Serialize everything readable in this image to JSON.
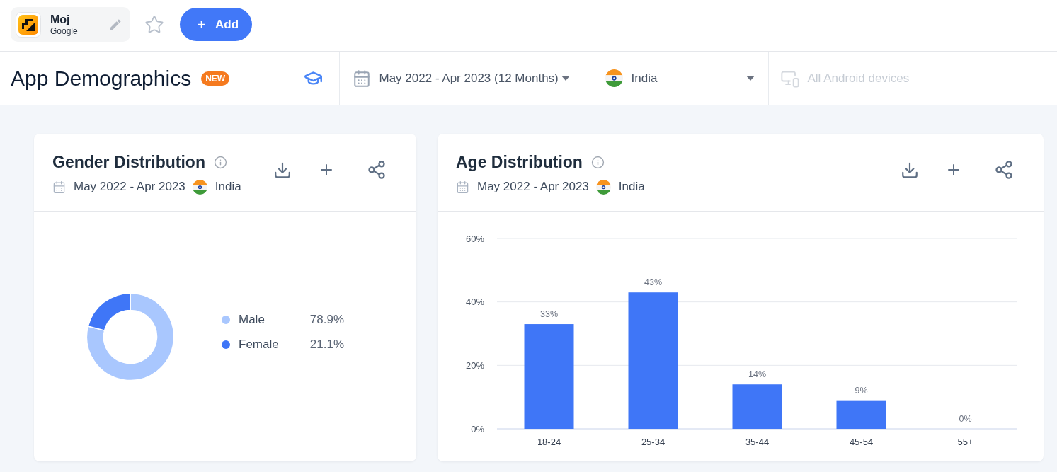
{
  "app": {
    "name": "Moj",
    "publisher": "Google"
  },
  "add_button": {
    "label": "Add"
  },
  "header": {
    "title": "App Demographics",
    "badge": "NEW"
  },
  "filters": [
    {
      "kind": "date",
      "label": "May 2022 - Apr 2023 (12 Months)",
      "disabled": false
    },
    {
      "kind": "country",
      "label": "India",
      "disabled": false
    },
    {
      "kind": "device",
      "label": "All Android devices",
      "disabled": true
    }
  ],
  "gender_card": {
    "title": "Gender Distribution",
    "period": "May 2022 - Apr 2023",
    "country": "India",
    "legend": [
      {
        "label": "Male",
        "value": "78.9%",
        "color": "#a9c7fe"
      },
      {
        "label": "Female",
        "value": "21.1%",
        "color": "#3f76f7"
      }
    ],
    "chart_data": {
      "type": "donut",
      "values": [
        78.9,
        21.1
      ]
    }
  },
  "age_card": {
    "title": "Age Distribution",
    "period": "May 2022 - Apr 2023",
    "country": "India",
    "chart_data": {
      "type": "bar",
      "categories": [
        "18-24",
        "25-34",
        "35-44",
        "45-54",
        "55+"
      ],
      "values": [
        33,
        43,
        14,
        9,
        0
      ],
      "value_labels": [
        "33%",
        "43%",
        "14%",
        "9%",
        "0%"
      ],
      "ylim": [
        0,
        60
      ],
      "yticks": [
        {
          "value": 0,
          "label": "0%"
        },
        {
          "value": 20,
          "label": "20%"
        },
        {
          "value": 40,
          "label": "40%"
        },
        {
          "value": 60,
          "label": "60%"
        }
      ]
    }
  }
}
